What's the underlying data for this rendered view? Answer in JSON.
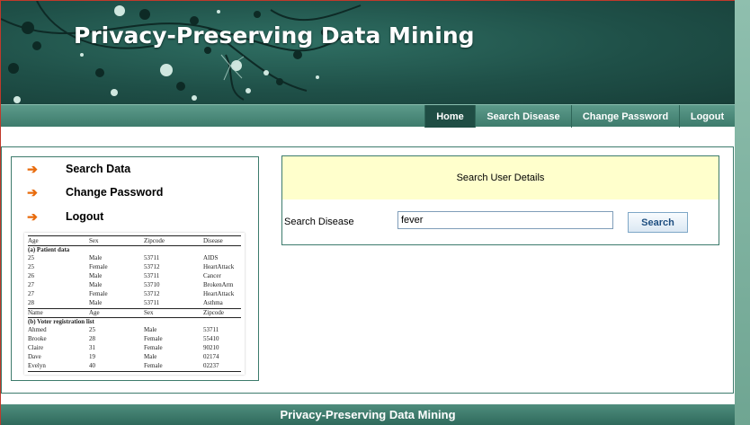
{
  "header": {
    "title": "Privacy-Preserving Data Mining"
  },
  "nav": {
    "items": [
      {
        "label": "Home",
        "active": true
      },
      {
        "label": "Search Disease",
        "active": false
      },
      {
        "label": "Change Password",
        "active": false
      },
      {
        "label": "Logout",
        "active": false
      }
    ]
  },
  "sidebar": {
    "items": [
      {
        "label": "Search Data",
        "icon": "arrow-right-icon"
      },
      {
        "label": "Change Password",
        "icon": "arrow-right-icon"
      },
      {
        "label": "Logout",
        "icon": "arrow-right-icon"
      }
    ]
  },
  "data_table": {
    "patient_headers": [
      "Age",
      "Sex",
      "Zipcode",
      "Disease"
    ],
    "patient_caption": "(a) Patient data",
    "patient_rows": [
      [
        "25",
        "Male",
        "53711",
        "AIDS"
      ],
      [
        "25",
        "Female",
        "53712",
        "HeartAttack"
      ],
      [
        "26",
        "Male",
        "53711",
        "Cancer"
      ],
      [
        "27",
        "Male",
        "53710",
        "BrokenArm"
      ],
      [
        "27",
        "Female",
        "53712",
        "HeartAttack"
      ],
      [
        "28",
        "Male",
        "53711",
        "Asthma"
      ]
    ],
    "voter_headers": [
      "Name",
      "Age",
      "Sex",
      "Zipcode"
    ],
    "voter_caption": "(b) Voter registration list",
    "voter_rows": [
      [
        "Ahmed",
        "25",
        "Male",
        "53711"
      ],
      [
        "Brooke",
        "28",
        "Female",
        "55410"
      ],
      [
        "Claire",
        "31",
        "Female",
        "90210"
      ],
      [
        "Dave",
        "19",
        "Male",
        "02174"
      ],
      [
        "Evelyn",
        "40",
        "Female",
        "02237"
      ]
    ]
  },
  "search": {
    "heading": "Search User Details",
    "label": "Search Disease",
    "input_value": "fever",
    "button_label": "Search"
  },
  "footer": {
    "text": "Privacy-Preserving Data Mining"
  },
  "colors": {
    "header_bg": "#1f5048",
    "nav_bg": "#3d7b6c",
    "accent_arrow": "#e86b0c",
    "search_head_bg": "#ffffcc"
  }
}
